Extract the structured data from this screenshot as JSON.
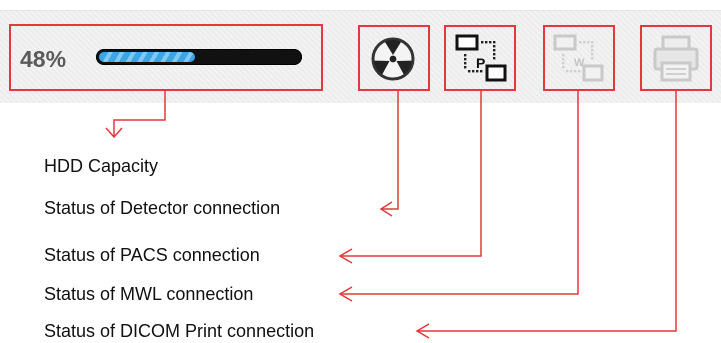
{
  "hdd": {
    "percent_text": "48%",
    "fill_fraction": 0.48
  },
  "icons": {
    "detector": "radiation-icon",
    "pacs": "pacs-network-icon",
    "mwl": "mwl-worklist-icon",
    "print": "printer-icon"
  },
  "colors": {
    "annotation": "#e2393c",
    "progress_fill": "#3aa6e6",
    "progress_track": "#111111"
  },
  "labels": {
    "hdd": "HDD Capacity",
    "detector": "Status of Detector connection",
    "pacs": "Status of PACS connection",
    "mwl": "Status of MWL connection",
    "print": "Status of DICOM Print connection"
  }
}
